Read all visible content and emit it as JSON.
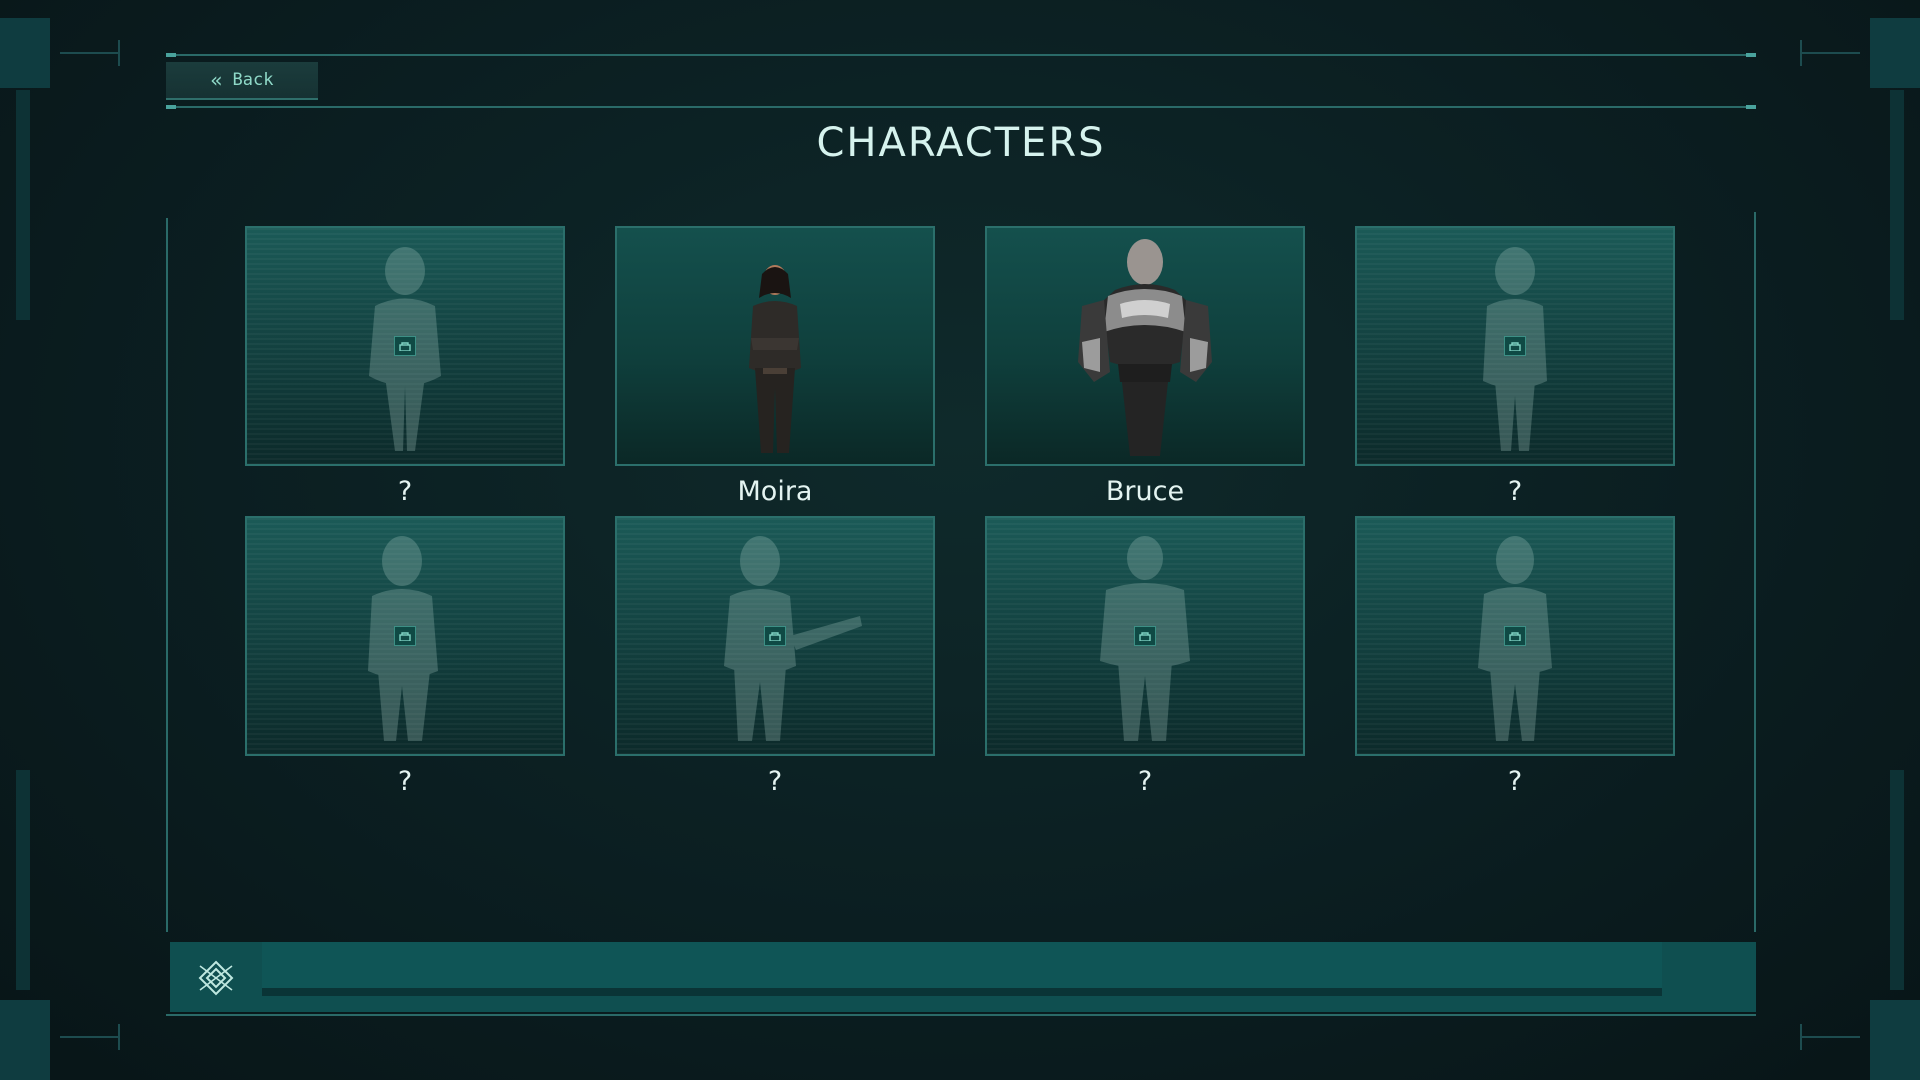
{
  "header": {
    "back_label": "Back",
    "title": "CHARACTERS"
  },
  "characters": [
    {
      "name": "?",
      "locked": true
    },
    {
      "name": "Moira",
      "locked": false
    },
    {
      "name": "Bruce",
      "locked": false
    },
    {
      "name": "?",
      "locked": true
    },
    {
      "name": "?",
      "locked": true
    },
    {
      "name": "?",
      "locked": true
    },
    {
      "name": "?",
      "locked": true
    },
    {
      "name": "?",
      "locked": true
    }
  ],
  "icons": {
    "back": "double-chevron-left-icon",
    "lock": "lock-icon",
    "emblem": "diamond-emblem-icon"
  },
  "colors": {
    "accent": "#2a6a68",
    "text": "#d6f3ee",
    "panel": "#0f4f50"
  }
}
